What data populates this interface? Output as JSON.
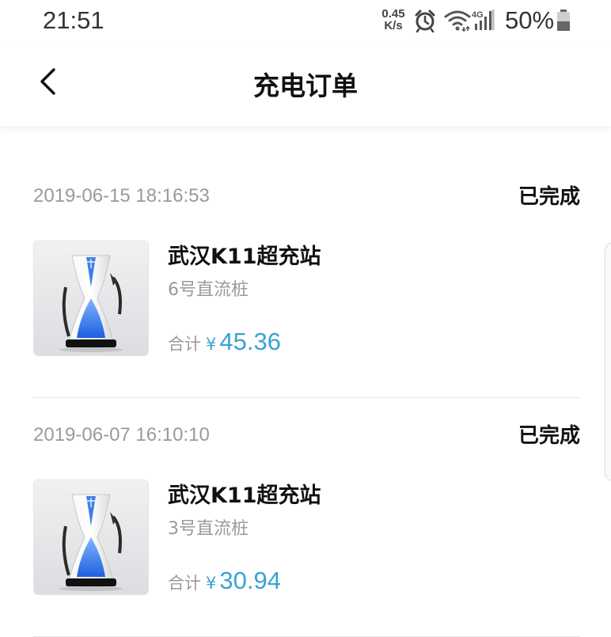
{
  "status_bar": {
    "time": "21:51",
    "net_speed_value": "0.45",
    "net_speed_unit": "K/s",
    "network_type": "4G",
    "battery": "50%"
  },
  "header": {
    "title": "充电订单",
    "icons": {
      "back": "chevron-left"
    }
  },
  "orders": [
    {
      "datetime": "2019-06-15 18:16:53",
      "status": "已完成",
      "station": "武汉K11超充站",
      "pile": "6号直流桩",
      "total_label": "合计",
      "currency": "¥",
      "amount": "45.36"
    },
    {
      "datetime": "2019-06-07 16:10:10",
      "status": "已完成",
      "station": "武汉K11超充站",
      "pile": "3号直流桩",
      "total_label": "合计",
      "currency": "¥",
      "amount": "30.94"
    }
  ],
  "colors": {
    "accent": "#38a3d1",
    "secondary_text": "#9a9a9a",
    "primary_text": "#111111"
  }
}
